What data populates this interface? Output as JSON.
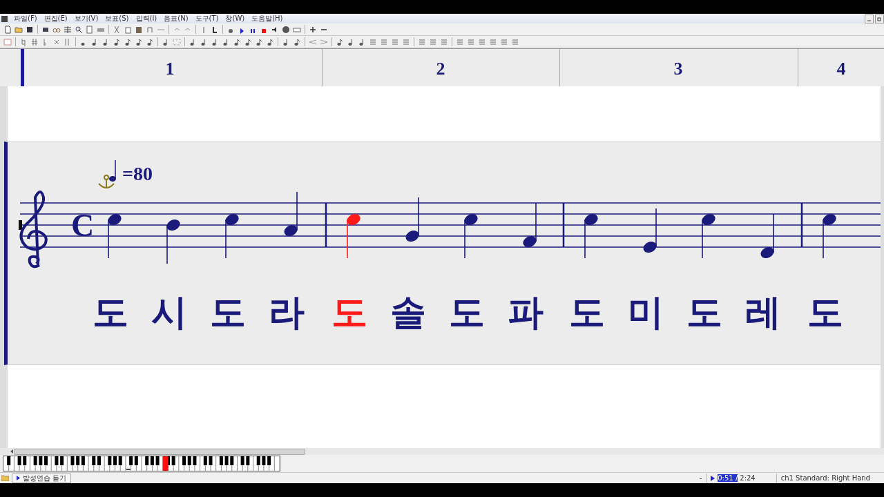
{
  "menu": [
    {
      "label": "파일(F)"
    },
    {
      "label": "편집(E)"
    },
    {
      "label": "보기(V)"
    },
    {
      "label": "보표(S)"
    },
    {
      "label": "입력(I)"
    },
    {
      "label": "음표(N)"
    },
    {
      "label": "도구(T)"
    },
    {
      "label": "창(W)"
    },
    {
      "label": "도움말(H)"
    }
  ],
  "score": {
    "tempo": "=80",
    "time_signature": "C",
    "measures": [
      {
        "number": "1",
        "notes": [
          {
            "kind": "c5",
            "lyric": "도",
            "selected": false
          },
          {
            "kind": "b4",
            "lyric": "시",
            "selected": false
          },
          {
            "kind": "c5",
            "lyric": "도",
            "selected": false
          },
          {
            "kind": "a4",
            "lyric": "라",
            "selected": false
          }
        ]
      },
      {
        "number": "2",
        "notes": [
          {
            "kind": "c5",
            "lyric": "도",
            "selected": true
          },
          {
            "kind": "g4",
            "lyric": "솔",
            "selected": false
          },
          {
            "kind": "c5",
            "lyric": "도",
            "selected": false
          },
          {
            "kind": "f4",
            "lyric": "파",
            "selected": false
          }
        ]
      },
      {
        "number": "3",
        "notes": [
          {
            "kind": "c5",
            "lyric": "도",
            "selected": false
          },
          {
            "kind": "e4",
            "lyric": "미",
            "selected": false
          },
          {
            "kind": "c5",
            "lyric": "도",
            "selected": false
          },
          {
            "kind": "d4",
            "lyric": "레",
            "selected": false
          }
        ]
      },
      {
        "number": "4",
        "notes": [
          {
            "kind": "c5",
            "lyric": "도",
            "selected": false
          }
        ]
      }
    ]
  },
  "status_bar": {
    "tab": "발성연습 듣기",
    "dash": "-",
    "position": "0:51 /",
    "duration": "2:24",
    "track": "ch1 Standard: Right Hand"
  }
}
